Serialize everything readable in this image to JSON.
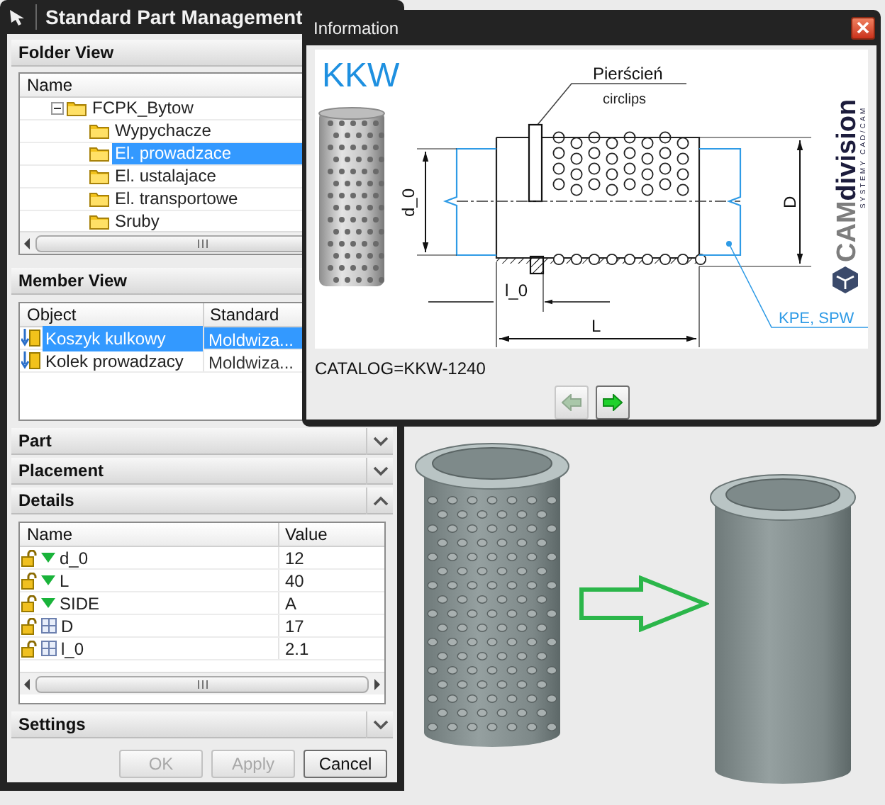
{
  "dialog": {
    "title": "Standard Part Management",
    "folder_view": {
      "title": "Folder View",
      "column": "Name",
      "tree": [
        {
          "label": "FCPK_Bytow",
          "expanded": true,
          "selected": false,
          "children": [
            {
              "label": "Wypychacze",
              "selected": false
            },
            {
              "label": "El. prowadzace",
              "selected": true
            },
            {
              "label": "El. ustalajace",
              "selected": false
            },
            {
              "label": "El. transportowe",
              "selected": false
            },
            {
              "label": "Sruby",
              "selected": false
            }
          ]
        }
      ]
    },
    "member_view": {
      "title": "Member View",
      "columns": [
        "Object",
        "Standard"
      ],
      "rows": [
        {
          "object": "Koszyk kulkowy",
          "standard": "Moldwiza...",
          "selected": true
        },
        {
          "object": "Kolek prowadzacy",
          "standard": "Moldwiza...",
          "selected": false
        }
      ]
    },
    "sections": [
      {
        "title": "Part",
        "expanded": false
      },
      {
        "title": "Placement",
        "expanded": false
      },
      {
        "title": "Details",
        "expanded": true,
        "table": {
          "columns": [
            "Name",
            "Value"
          ],
          "rows": [
            {
              "name": "d_0",
              "value": "12",
              "kind": "expression"
            },
            {
              "name": "L",
              "value": "40",
              "kind": "expression"
            },
            {
              "name": "SIDE",
              "value": "A",
              "kind": "expression"
            },
            {
              "name": "D",
              "value": "17",
              "kind": "parameter"
            },
            {
              "name": "l_0",
              "value": "2.1",
              "kind": "parameter"
            }
          ]
        }
      },
      {
        "title": "Settings",
        "expanded": false
      }
    ],
    "buttons": [
      {
        "label": "OK",
        "disabled": true
      },
      {
        "label": "Apply",
        "disabled": true
      },
      {
        "label": "Cancel",
        "disabled": false
      }
    ]
  },
  "info_window": {
    "title": "Information",
    "drawing": {
      "title": "KKW",
      "ring_label": "Pierścień",
      "ring_sublabel": "circlips",
      "dim_inner": "d_0",
      "dim_outer": "D",
      "dim_ring": "l_0",
      "dim_length": "L",
      "mating_parts": "KPE, SPW",
      "logo_main": "CAM",
      "logo_accent": "division",
      "logo_tagline": "SYSTEMY CAD/CAM"
    },
    "catalog": "CATALOG=KKW-1240",
    "nav_buttons": [
      {
        "kind": "back",
        "disabled": true
      },
      {
        "kind": "forward",
        "disabled": false
      }
    ]
  }
}
